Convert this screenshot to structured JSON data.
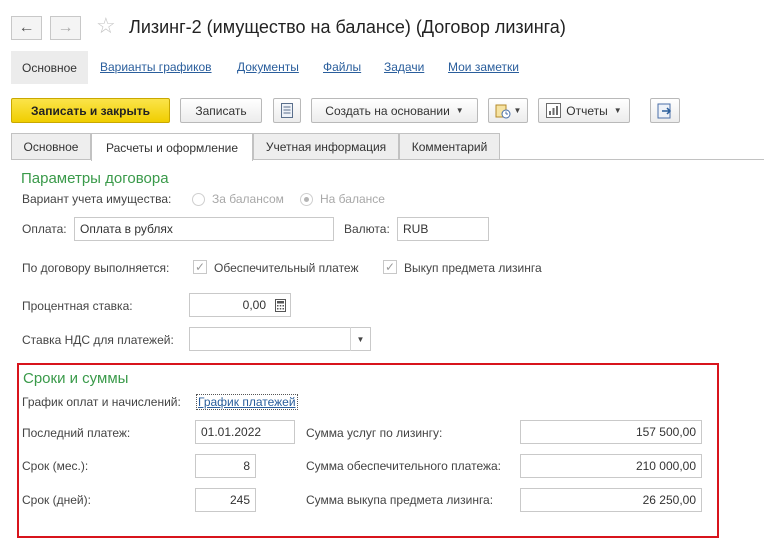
{
  "window": {
    "title": "Лизинг-2 (имущество на балансе) (Договор лизинга)",
    "back_icon": "arrow-left-icon",
    "forward_icon": "arrow-right-icon",
    "favorite_icon": "star-icon"
  },
  "link_tabs": [
    {
      "label": "Основное",
      "active": true
    },
    {
      "label": "Варианты графиков"
    },
    {
      "label": "Документы"
    },
    {
      "label": "Файлы"
    },
    {
      "label": "Задачи"
    },
    {
      "label": "Мои заметки"
    }
  ],
  "toolbar": {
    "save_close": "Записать и закрыть",
    "save": "Записать",
    "create_based": "Создать на основании",
    "reports": "Отчеты"
  },
  "page_tabs": [
    {
      "label": "Основное"
    },
    {
      "label": "Расчеты и оформление",
      "active": true
    },
    {
      "label": "Учетная информация"
    },
    {
      "label": "Комментарий"
    }
  ],
  "contract_params": {
    "title": "Параметры договора",
    "accounting_variant_label": "Вариант учета имущества:",
    "option_off": "За балансом",
    "option_on": "На балансе",
    "payment_label": "Оплата:",
    "payment_value": "Оплата в рублях",
    "currency_label": "Валюта:",
    "currency_value": "RUB",
    "executed_label": "По договору выполняется:",
    "security_payment_label": "Обеспечительный  платеж",
    "security_payment_checked": true,
    "buyout_label": "Выкуп предмета лизинга",
    "buyout_checked": true,
    "interest_rate_label": "Процентная ставка:",
    "interest_rate_value": "0,00",
    "vat_rate_label": "Ставка НДС для платежей:",
    "vat_rate_value": ""
  },
  "terms": {
    "title": "Сроки и суммы",
    "schedule_label": "График оплат и начислений:",
    "schedule_link": " График платежей",
    "last_payment_label": "Последний платеж:",
    "last_payment_value": "01.01.2022",
    "term_months_label": "Срок (мес.):",
    "term_months_value": "8",
    "term_days_label": "Срок (дней):",
    "term_days_value": "245",
    "leasing_services_label": "Сумма услуг по лизингу:",
    "leasing_services_value": "157 500,00",
    "security_sum_label": "Сумма обеспечительного платежа:",
    "security_sum_value": "210 000,00",
    "buyout_sum_label": "Сумма выкупа предмета лизинга:",
    "buyout_sum_value": "26 250,00"
  },
  "colors": {
    "accent_green": "#3a9a4a",
    "primary_button": "#f0ce00",
    "link_blue": "#2a5e9c",
    "highlight_red": "#d8141c"
  }
}
